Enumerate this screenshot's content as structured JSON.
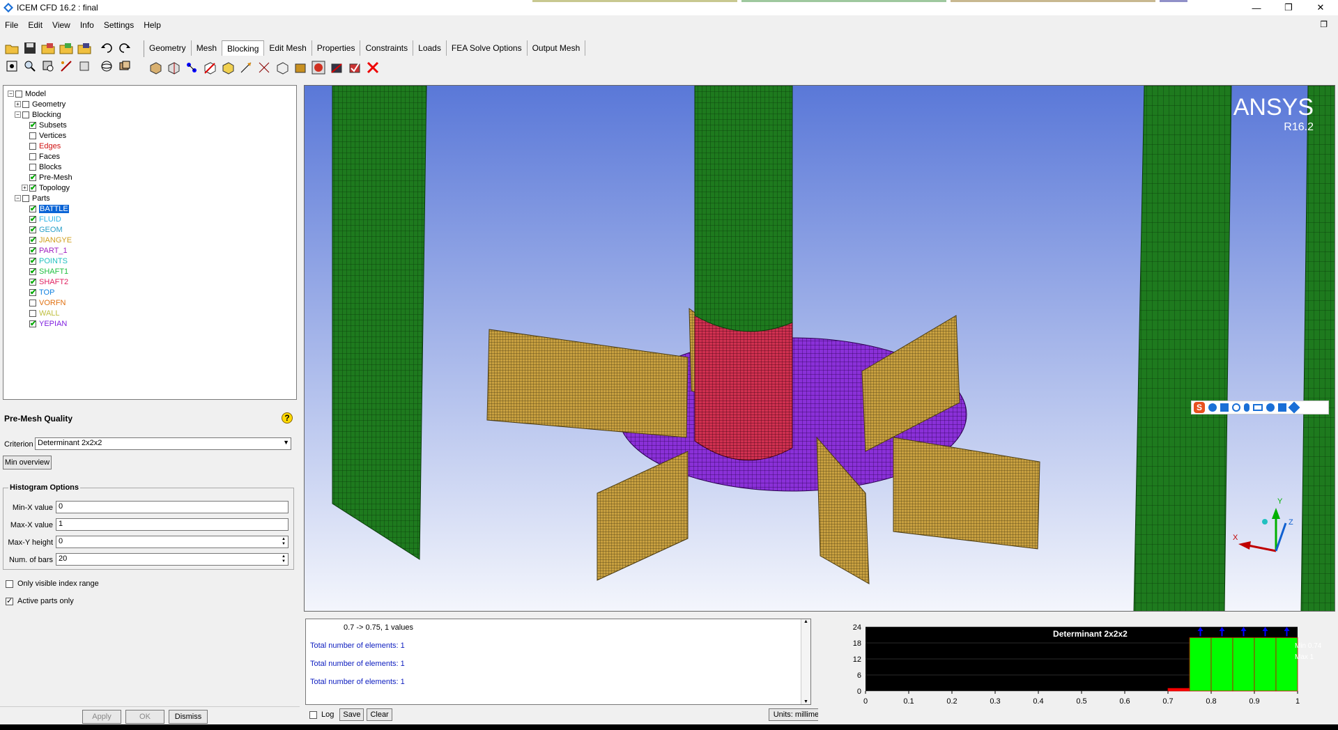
{
  "window": {
    "title": "ICEM CFD 16.2 : final",
    "minimize": "—",
    "maximize": "❐",
    "close": "✕"
  },
  "menu": [
    "File",
    "Edit",
    "View",
    "Info",
    "Settings",
    "Help"
  ],
  "tabs": [
    "Geometry",
    "Mesh",
    "Blocking",
    "Edit Mesh",
    "Properties",
    "Constraints",
    "Loads",
    "FEA Solve Options",
    "Output Mesh"
  ],
  "active_tab": "Blocking",
  "tree": [
    {
      "label": "Model",
      "level": 0,
      "exp": "−",
      "check": false,
      "color": "#000"
    },
    {
      "label": "Geometry",
      "level": 1,
      "exp": "+",
      "check": false,
      "color": "#000"
    },
    {
      "label": "Blocking",
      "level": 1,
      "exp": "−",
      "check": false,
      "color": "#000"
    },
    {
      "label": "Subsets",
      "level": 2,
      "exp": "",
      "check": true,
      "color": "#000"
    },
    {
      "label": "Vertices",
      "level": 2,
      "exp": "",
      "check": false,
      "color": "#000"
    },
    {
      "label": "Edges",
      "level": 2,
      "exp": "",
      "check": false,
      "color": "#d01010"
    },
    {
      "label": "Faces",
      "level": 2,
      "exp": "",
      "check": false,
      "color": "#000"
    },
    {
      "label": "Blocks",
      "level": 2,
      "exp": "",
      "check": false,
      "color": "#000"
    },
    {
      "label": "Pre-Mesh",
      "level": 2,
      "exp": "",
      "check": true,
      "color": "#000"
    },
    {
      "label": "Topology",
      "level": 2,
      "exp": "+",
      "check": true,
      "color": "#000"
    },
    {
      "label": "Parts",
      "level": 1,
      "exp": "−",
      "check": false,
      "color": "#000"
    },
    {
      "label": "BATTLE",
      "level": 2,
      "exp": "",
      "check": true,
      "color": "#fff",
      "selected": true
    },
    {
      "label": "FLUID",
      "level": 2,
      "exp": "",
      "check": true,
      "color": "#2ab4e8"
    },
    {
      "label": "GEOM",
      "level": 2,
      "exp": "",
      "check": true,
      "color": "#2aa0c8"
    },
    {
      "label": "JIANGYE",
      "level": 2,
      "exp": "",
      "check": true,
      "color": "#d0a020"
    },
    {
      "label": "PART_1",
      "level": 2,
      "exp": "",
      "check": true,
      "color": "#a020c0"
    },
    {
      "label": "POINTS",
      "level": 2,
      "exp": "",
      "check": true,
      "color": "#20c0c0"
    },
    {
      "label": "SHAFT1",
      "level": 2,
      "exp": "",
      "check": true,
      "color": "#20c040"
    },
    {
      "label": "SHAFT2",
      "level": 2,
      "exp": "",
      "check": true,
      "color": "#e02060"
    },
    {
      "label": "TOP",
      "level": 2,
      "exp": "",
      "check": true,
      "color": "#1080e0"
    },
    {
      "label": "VORFN",
      "level": 2,
      "exp": "",
      "check": false,
      "color": "#e07010"
    },
    {
      "label": "WALL",
      "level": 2,
      "exp": "",
      "check": false,
      "color": "#c0c040"
    },
    {
      "label": "YEPIAN",
      "level": 2,
      "exp": "",
      "check": true,
      "color": "#8020e0"
    }
  ],
  "premesh": {
    "header": "Pre-Mesh Quality",
    "criterion_label": "Criterion",
    "criterion_value": "Determinant 2x2x2",
    "min_overview": "Min overview",
    "hist_title": "Histogram Options",
    "minx_label": "Min-X value",
    "minx": "0",
    "maxx_label": "Max-X value",
    "maxx": "1",
    "maxy_label": "Max-Y height",
    "maxy": "0",
    "bars_label": "Num. of bars",
    "bars": "20",
    "only_visible": "Only visible index range",
    "active_parts": "Active parts only",
    "apply": "Apply",
    "ok": "OK",
    "dismiss": "Dismiss"
  },
  "viewport": {
    "brand": "ANSYS",
    "version": "R16.2",
    "axis_x": "X",
    "axis_y": "Y",
    "axis_z": "Z"
  },
  "console": {
    "lines": [
      "0.7 -> 0.75, 1 values",
      "Total number of elements: 1",
      "Total number of elements: 1",
      "Total number of elements: 1"
    ],
    "log": "Log",
    "save": "Save",
    "clear": "Clear",
    "units": "Units: millimeters"
  },
  "chart_data": {
    "type": "bar",
    "title": "Determinant 2x2x2",
    "x_ticks": [
      "0",
      "0.1",
      "0.2",
      "0.3",
      "0.4",
      "0.5",
      "0.6",
      "0.7",
      "0.8",
      "0.9",
      "1"
    ],
    "y_ticks": [
      "24",
      "18",
      "12",
      "6",
      "0"
    ],
    "xlim": [
      0,
      1
    ],
    "ylim": [
      0,
      24
    ],
    "bins": [
      [
        0.7,
        0.75,
        1
      ],
      [
        0.75,
        0.8,
        20
      ],
      [
        0.8,
        0.85,
        20
      ],
      [
        0.85,
        0.9,
        20
      ],
      [
        0.9,
        0.95,
        20
      ],
      [
        0.95,
        1.0,
        20
      ]
    ],
    "min_label": "Min 0.74",
    "max_label": "Max 1",
    "bar_color": "#00ff00",
    "low_bar_color": "#ff0000"
  }
}
